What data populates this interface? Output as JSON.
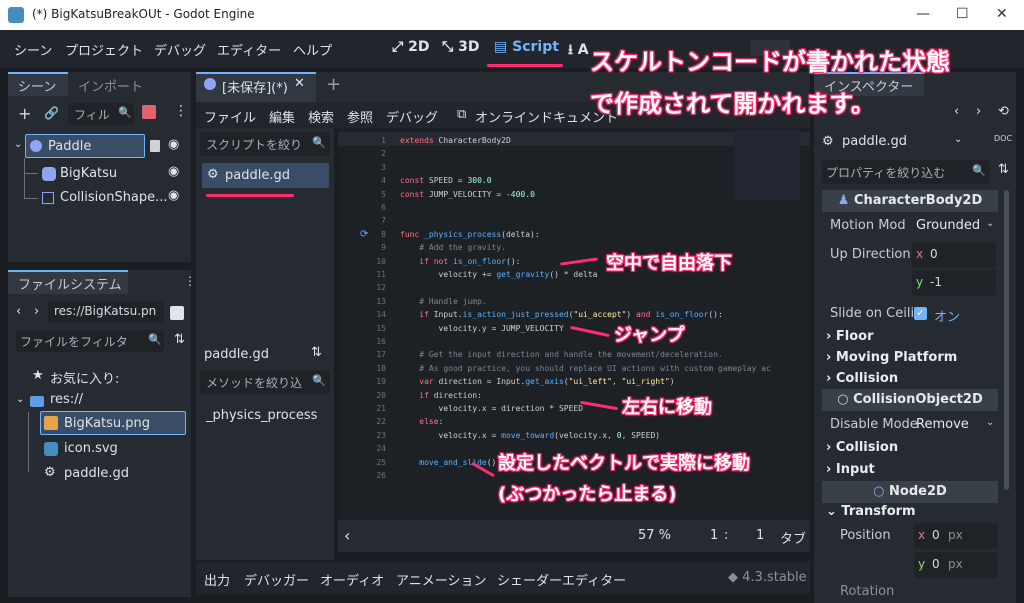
{
  "window": {
    "title": "(*) BigKatsuBreakOUt - Godot Engine",
    "minimize": "—",
    "maximize": "☐",
    "close": "✕"
  },
  "menu": [
    "シーン",
    "プロジェクト",
    "デバッグ",
    "エディター",
    "ヘルプ"
  ],
  "workspaces": {
    "2d": "2D",
    "3d": "3D",
    "script": "Script",
    "assetlib": "A"
  },
  "scene_dock": {
    "tabs": [
      "シーン",
      "インポート"
    ],
    "filter_placeholder": "フィル",
    "nodes": [
      {
        "name": "Paddle",
        "icon": "character-body-icon"
      },
      {
        "name": "BigKatsu",
        "icon": "sprite-icon"
      },
      {
        "name": "CollisionShape...",
        "icon": "collision-shape-icon"
      }
    ]
  },
  "fs_dock": {
    "title": "ファイルシステム",
    "path": "res://BigKatsu.pn",
    "filter_placeholder": "ファイルをフィルタ",
    "favorites": "お気に入り:",
    "root": "res://",
    "files": [
      "BigKatsu.png",
      "icon.svg",
      "paddle.gd"
    ]
  },
  "script_editor": {
    "tab": "[未保存](*)",
    "add_tab": "+",
    "menu": [
      "ファイル",
      "編集",
      "検索",
      "参照",
      "デバッグ",
      "オンラインドキュメント"
    ],
    "script_filter": "スクリプトを絞り",
    "scripts": [
      "paddle.gd"
    ],
    "current_file": "paddle.gd",
    "method_filter": "メソッドを絞り込",
    "methods": [
      "_physics_process"
    ],
    "status": {
      "zoom": "57 %",
      "line": "1",
      "col": "1",
      "tab": "タブ",
      "back": "‹"
    }
  },
  "code": [
    {
      "n": "1",
      "text": "extends CharacterBody2D"
    },
    {
      "n": "2",
      "text": ""
    },
    {
      "n": "3",
      "text": ""
    },
    {
      "n": "4",
      "text": "const SPEED = 300.0"
    },
    {
      "n": "5",
      "text": "const JUMP_VELOCITY = -400.0"
    },
    {
      "n": "6",
      "text": ""
    },
    {
      "n": "7",
      "text": ""
    },
    {
      "n": "8",
      "text": "func _physics_process(delta):"
    },
    {
      "n": "9",
      "text": "    # Add the gravity."
    },
    {
      "n": "10",
      "text": "    if not is_on_floor():"
    },
    {
      "n": "11",
      "text": "        velocity += get_gravity() * delta"
    },
    {
      "n": "12",
      "text": ""
    },
    {
      "n": "13",
      "text": "    # Handle jump."
    },
    {
      "n": "14",
      "text": "    if Input.is_action_just_pressed(\"ui_accept\") and is_on_floor():"
    },
    {
      "n": "15",
      "text": "        velocity.y = JUMP_VELOCITY"
    },
    {
      "n": "16",
      "text": ""
    },
    {
      "n": "17",
      "text": "    # Get the input direction and handle the movement/deceleration."
    },
    {
      "n": "18",
      "text": "    # As good practice, you should replace UI actions with custom gameplay ac"
    },
    {
      "n": "19",
      "text": "    var direction = Input.get_axis(\"ui_left\", \"ui_right\")"
    },
    {
      "n": "20",
      "text": "    if direction:"
    },
    {
      "n": "21",
      "text": "        velocity.x = direction * SPEED"
    },
    {
      "n": "22",
      "text": "    else:"
    },
    {
      "n": "23",
      "text": "        velocity.x = move_toward(velocity.x, 0, SPEED)"
    },
    {
      "n": "24",
      "text": ""
    },
    {
      "n": "25",
      "text": "    move_and_slide()"
    },
    {
      "n": "26",
      "text": ""
    }
  ],
  "bottom": {
    "tabs": [
      "出力",
      "デバッガー",
      "オーディオ",
      "アニメーション",
      "シェーダーエディター"
    ],
    "version": "4.3.stable"
  },
  "inspector": {
    "title": "インスペクター",
    "resource": "paddle.gd",
    "filter_placeholder": "プロパティを絞り込む",
    "class1": "CharacterBody2D",
    "motion_mode_label": "Motion Mod",
    "motion_mode_value": "Grounded",
    "up_direction_label": "Up Direction",
    "up_x": "0",
    "up_y": "-1",
    "slide_label": "Slide on Ceili",
    "slide_value": "オン",
    "sections1": [
      "Floor",
      "Moving Platform",
      "Collision"
    ],
    "class2": "CollisionObject2D",
    "disable_mode_label": "Disable Mode",
    "disable_mode_value": "Remove",
    "sections2": [
      "Collision",
      "Input"
    ],
    "class3": "Node2D",
    "transform": "Transform",
    "position_label": "Position",
    "pos_x": "0",
    "pos_y": "0",
    "px": "px",
    "rotation_label": "Rotation"
  },
  "annotations": {
    "header1": "スケルトンコードが書かれた状態",
    "header2": "で作成されて開かれます。",
    "gravity": "空中で自由落下",
    "jump": "ジャンプ",
    "move": "左右に移動",
    "slide1": "設定したベクトルで実際に移動",
    "slide2": "(ぶつかったら止まる)"
  },
  "colors": {
    "accent": "#70b4ff",
    "annotation": "#ff2d6f",
    "bg": "#1a1d22",
    "panel": "#262b32"
  }
}
